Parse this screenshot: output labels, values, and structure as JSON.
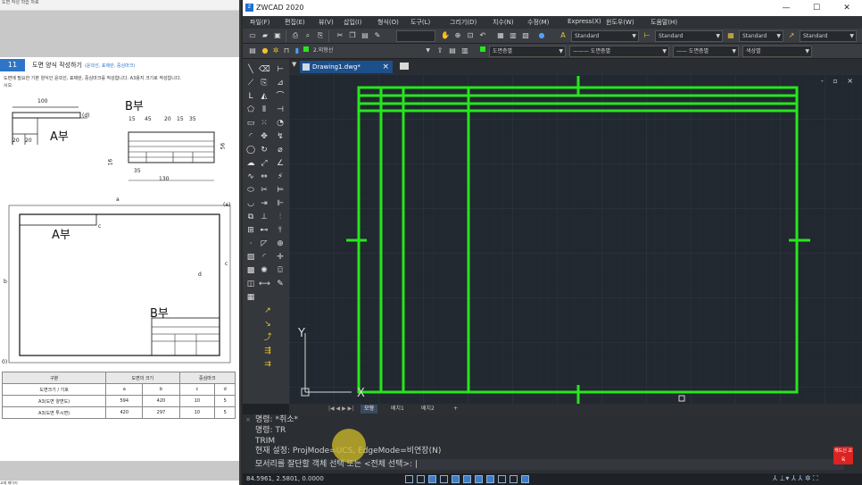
{
  "document": {
    "topbar_text": "도면 작성 학습 자료",
    "section_number": "11",
    "section_title": "도면 양식 작성하기",
    "section_subtitle": "(윤곽선, 표제란, 중심마크)",
    "intro_line1": "도면에 필요한 기본 양식인 윤곽선, 표제란, 중심마크를 작성합니다. A3용지 크기로 작성합니다.",
    "intro_line2": "시오.",
    "label_a_part": "A부",
    "label_b_part_top": "B부",
    "label_a_part_lower": "A부",
    "label_b_part_lower": "B부",
    "dim_100": "100",
    "dim_20a": "20",
    "dim_20b": "20",
    "dim_d": "(d)",
    "dim_15a": "15",
    "dim_45": "45",
    "dim_20": "20",
    "dim_15b": "15",
    "dim_35": "35",
    "dim_130": "130",
    "dim_56": "56",
    "dim_16": "16",
    "letter_a": "a",
    "letter_b": "b",
    "letter_c1": "c",
    "letter_c2": "c",
    "letter_d": "d",
    "letter_e": "(e)",
    "letter_f": "0)",
    "table": {
      "headers": [
        "구분",
        "도면의 크기",
        "",
        "중심마크",
        ""
      ],
      "sub_headers": [
        "도면크기 / 기호",
        "a",
        "b",
        "c",
        "d"
      ],
      "rows": [
        [
          "A3(도면 양면도)",
          "594",
          "420",
          "10",
          "5"
        ],
        [
          "A3(도면 투시면)",
          "420",
          "297",
          "10",
          "5"
        ]
      ]
    },
    "bottom_text": "교재 페이지"
  },
  "cad": {
    "app_title": "ZWCAD 2020",
    "app_icon": "Z",
    "window_controls": [
      "—",
      "☐",
      "✕"
    ],
    "menus": [
      "파일(F)",
      "편집(E)",
      "뷰(V)",
      "삽입(I)",
      "형식(O)",
      "도구(L)",
      "그리기(D)",
      "치수(N)",
      "수정(M)",
      "Express(X)",
      "윈도우(W)",
      "도움말(H)"
    ],
    "style_combos": [
      "Standard",
      "Standard",
      "Standard",
      "Standard"
    ],
    "layer_name": "2.외형선",
    "property_combos": [
      "도면층별",
      "도면층별",
      "도면층별",
      "색상별"
    ],
    "drawing_tab": "Drawing1.dwg*",
    "drawing_tab_close": "×",
    "tab_menu_icon": "▼",
    "viewport_controls": "- ▫ ×",
    "ucs": {
      "x_label": "X",
      "y_label": "Y"
    },
    "layout_tabs": [
      "모형",
      "배치1",
      "배치2",
      "+"
    ],
    "layout_nav": "|◀ ◀ ▶ ▶|",
    "command_history": [
      "명령: *취소*",
      "명령: TR",
      "TRIM",
      "현재 설정: ProjMode=UCS, EdgeMode=비연장(N)"
    ],
    "command_prompt": "모서리를 잘단할 객체 선택 또는 <전체 선택>: |",
    "badge_text": "캐드신 교육",
    "coordinates": "84.5961, 2.5801, 0.0000",
    "status_right": "⅄ ⊥▾ ⅄ ⅄ ✲ ⛶",
    "colors": {
      "geometry": "#27e61c",
      "viewport_bg": "#212830",
      "accent": "#1d4f8a"
    }
  }
}
